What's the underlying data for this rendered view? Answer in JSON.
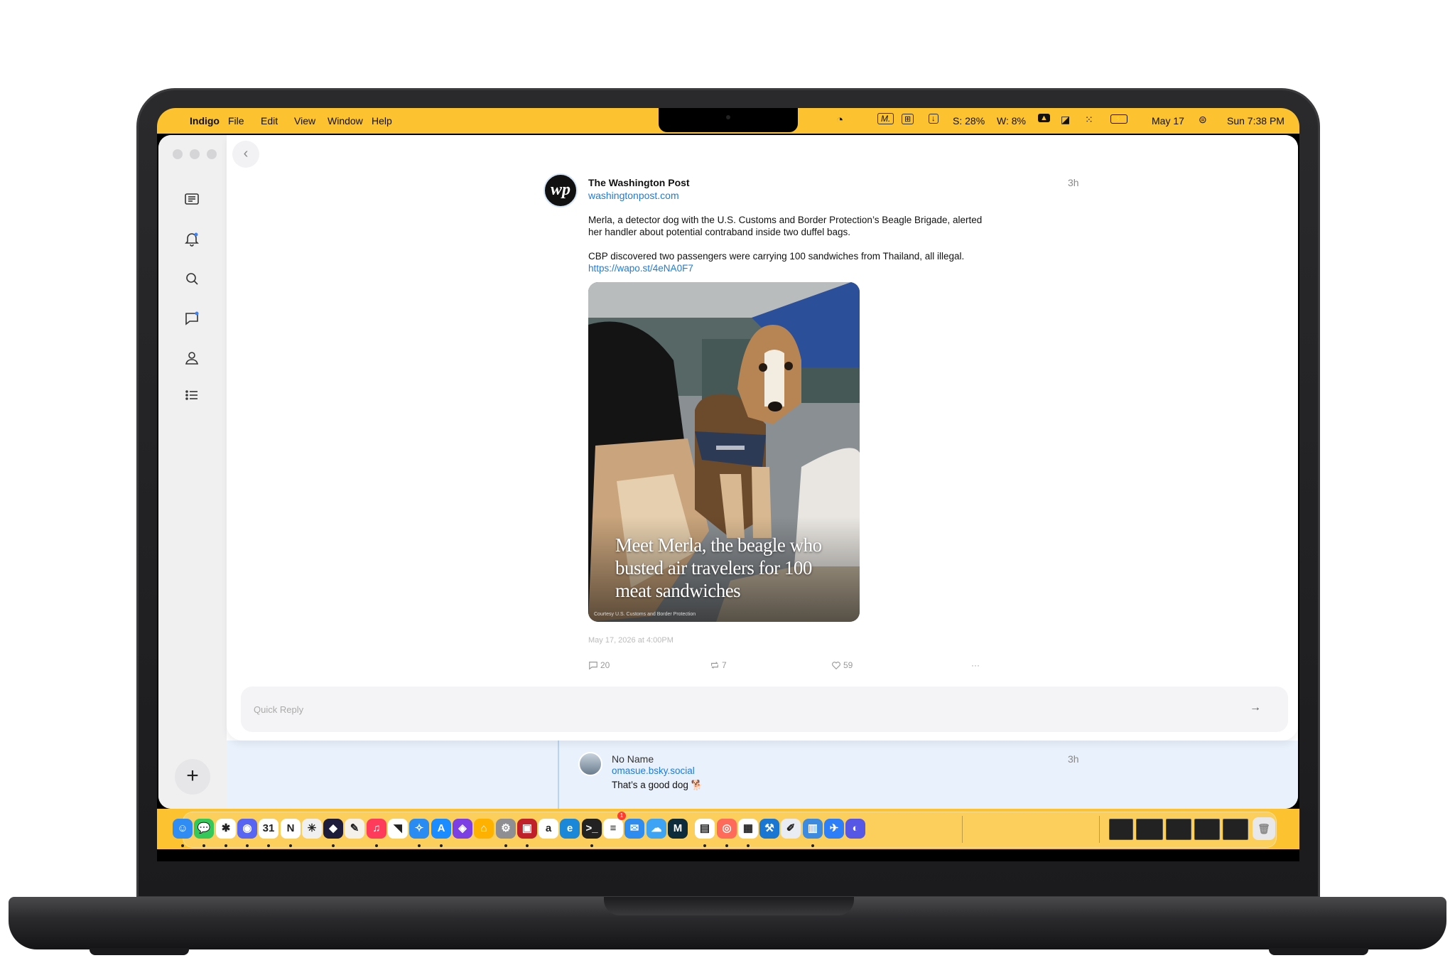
{
  "menubar": {
    "app_name": "Indigo",
    "menus": [
      "File",
      "Edit",
      "View",
      "Window",
      "Help"
    ],
    "status": {
      "storage": "S: 28%",
      "wifi": "W: 8%",
      "date": "May 17",
      "datetime": "Sun 7:38 PM"
    }
  },
  "sidebar": {
    "items": [
      {
        "icon": "timeline-icon"
      },
      {
        "icon": "bell-icon"
      },
      {
        "icon": "search-icon"
      },
      {
        "icon": "chat-icon"
      },
      {
        "icon": "profile-icon"
      },
      {
        "icon": "list-icon"
      }
    ],
    "compose_label": "+"
  },
  "post": {
    "author_name": "The Washington Post",
    "author_handle": "washingtonpost.com",
    "avatar_text": "wp",
    "time": "3h",
    "paragraph1": "Merla, a detector dog with the U.S. Customs and Border Protection’s Beagle Brigade, alerted her handler about potential contraband inside two duffel bags.",
    "paragraph2": "CBP discovered two passengers were carrying 100 sandwiches from Thailand, all illegal.",
    "link": "https://wapo.st/4eNA0F7",
    "image_headline": "Meet Merla, the beagle who busted air travelers for 100 meat sandwiches",
    "image_credit": "Courtesy U.S. Customs and Border Protection",
    "date": "May 17, 2026 at 4:00PM",
    "replies": "20",
    "reposts": "7",
    "likes": "59",
    "more": "···"
  },
  "quick_reply": {
    "placeholder": "Quick Reply"
  },
  "reply": {
    "name": "No Name",
    "handle": "omasue.bsky.social",
    "text": "That’s a good dog 🐕",
    "time": "3h"
  },
  "dock": {
    "apps": [
      "finder",
      "messages",
      "slack",
      "discord",
      "calendar",
      "notion",
      "claude",
      "arc",
      "pixelmator",
      "music",
      "netnewswire",
      "safari",
      "app-store",
      "shortcuts",
      "home",
      "system-settings",
      "photo-booth",
      "amazon",
      "edge",
      "terminal",
      "reminders",
      "mail",
      "tot",
      "ivory",
      "fantastical",
      "lasso",
      "notes",
      "xcode",
      "script-editor",
      "preview",
      "testflight",
      "quicktime"
    ],
    "system_settings_badge": "1"
  }
}
